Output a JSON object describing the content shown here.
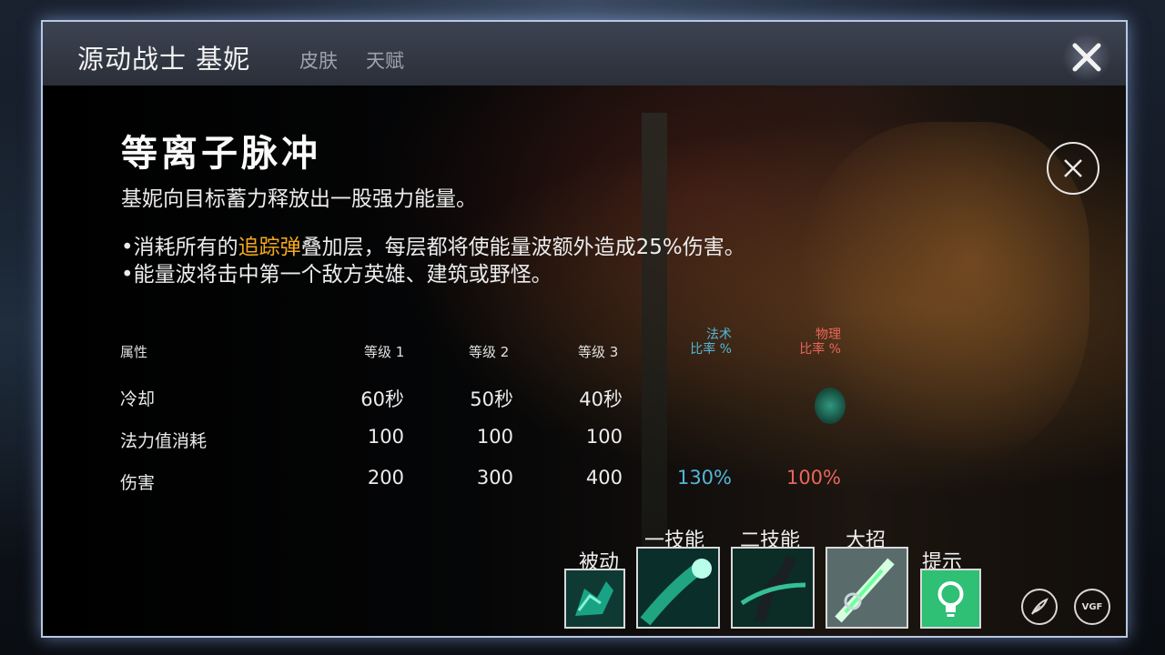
{
  "header": {
    "hero_name": "源动战士 基妮",
    "tabs": [
      "皮肤",
      "天赋"
    ]
  },
  "skill": {
    "name": "等离子脉冲",
    "description": "基妮向目标蓄力释放出一股强力能量。",
    "bullet1_prefix": "•消耗所有的",
    "bullet1_highlight": "追踪弹",
    "bullet1_suffix": "叠加层，每层都将使能量波额外造成25%伤害。",
    "bullet2": "•能量波将击中第一个敌方英雄、建筑或野怪。"
  },
  "stats": {
    "headers": {
      "attribute": "属性",
      "level1": "等级 1",
      "level2": "等级 2",
      "level3": "等级 3",
      "magic_line1": "法术",
      "magic_line2": "比率 %",
      "phys_line1": "物理",
      "phys_line2": "比率 %"
    },
    "rows": [
      {
        "label": "冷却",
        "values": [
          "60秒",
          "50秒",
          "40秒"
        ],
        "magic": "",
        "phys": ""
      },
      {
        "label": "法力值消耗",
        "values": [
          "100",
          "100",
          "100"
        ],
        "magic": "",
        "phys": ""
      },
      {
        "label": "伤害",
        "values": [
          "200",
          "300",
          "400"
        ],
        "magic": "130%",
        "phys": "100%"
      }
    ]
  },
  "skill_tabs": [
    {
      "label": "被动",
      "icon": "passive-skill-icon"
    },
    {
      "label": "一技能",
      "icon": "skill-1-icon"
    },
    {
      "label": "二技能",
      "icon": "skill-2-icon"
    },
    {
      "label": "大招",
      "icon": "ultimate-icon"
    },
    {
      "label": "提示",
      "icon": "lightbulb-icon"
    }
  ],
  "colors": {
    "highlight": "#f3a91f",
    "magic": "#53b6d9",
    "physical": "#e8665a",
    "frame": "#b8c7e6"
  },
  "bottom_buttons": {
    "feather_icon": "feather-icon",
    "vgf_label": "VGF"
  }
}
